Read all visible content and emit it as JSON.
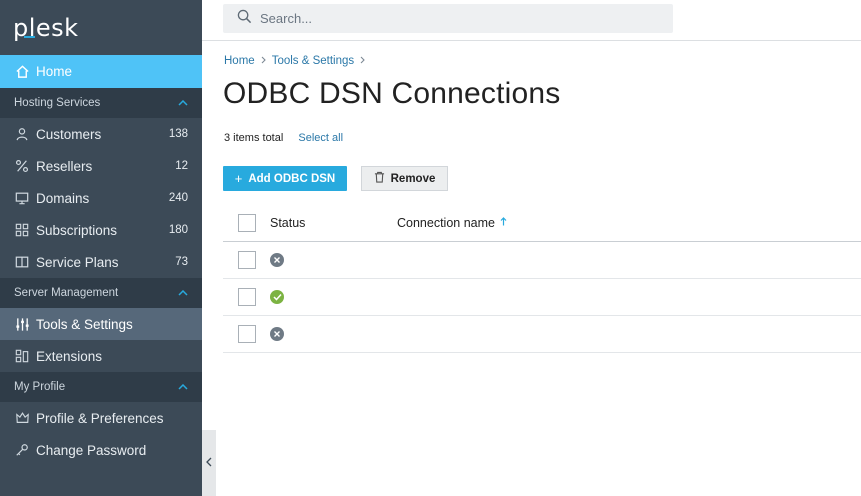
{
  "sidebar": {
    "logo": "plesk",
    "home_label": "Home",
    "sections": {
      "hosting": "Hosting Services",
      "server": "Server Management",
      "profile": "My Profile"
    },
    "hosting_items": [
      {
        "label": "Customers",
        "count": "138",
        "icon": "user-icon"
      },
      {
        "label": "Resellers",
        "count": "12",
        "icon": "percent-icon"
      },
      {
        "label": "Domains",
        "count": "240",
        "icon": "monitor-icon"
      },
      {
        "label": "Subscriptions",
        "count": "180",
        "icon": "grid-icon"
      },
      {
        "label": "Service Plans",
        "count": "73",
        "icon": "book-icon"
      }
    ],
    "server_items": [
      {
        "label": "Tools & Settings",
        "icon": "sliders-icon"
      },
      {
        "label": "Extensions",
        "icon": "extensions-icon"
      }
    ],
    "profile_items": [
      {
        "label": "Profile & Preferences",
        "icon": "crown-icon"
      },
      {
        "label": "Change Password",
        "icon": "key-icon"
      }
    ]
  },
  "search": {
    "placeholder": "Search..."
  },
  "breadcrumb": {
    "home": "Home",
    "tools": "Tools & Settings"
  },
  "page_title": "ODBC DSN Connections",
  "items_total": "3 items total",
  "select_all": "Select all",
  "toolbar": {
    "add_label": "Add ODBC DSN",
    "remove_label": "Remove"
  },
  "table": {
    "headers": {
      "status": "Status",
      "name": "Connection name"
    },
    "rows": [
      {
        "status": "off",
        "name": ""
      },
      {
        "status": "on",
        "name": ""
      },
      {
        "status": "off",
        "name": ""
      }
    ]
  },
  "colors": {
    "accent": "#28aade",
    "sidebar": "#3c4a57",
    "ok": "#7cb342",
    "off": "#6f7a85"
  }
}
